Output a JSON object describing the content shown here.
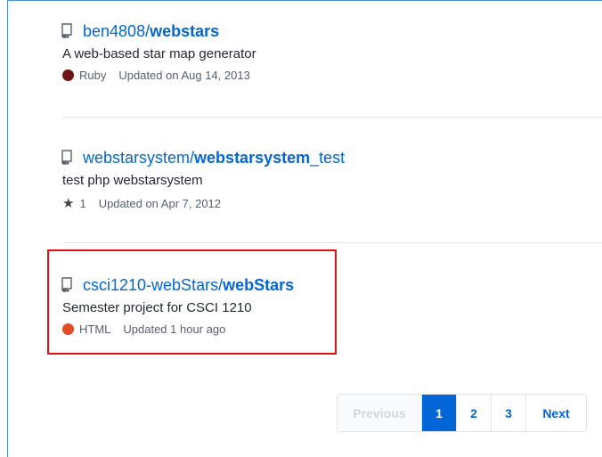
{
  "colors": {
    "link": "#0366d6",
    "ruby": "#701516",
    "html": "#e34c26",
    "highlight": "#dd1111"
  },
  "repos": [
    {
      "owner": "ben4808/",
      "name": "webstars",
      "name_suffix": "",
      "description": "A web-based star map generator",
      "language": "Ruby",
      "updated": "Updated on Aug 14, 2013"
    },
    {
      "owner": "webstarsystem/",
      "name": "webstarsystem",
      "name_suffix": "_test",
      "description": "test php webstarsystem",
      "stars": "1",
      "updated": "Updated on Apr 7, 2012"
    },
    {
      "owner": "csci1210-webStars/",
      "name": "webStars",
      "name_suffix": "",
      "description": "Semester project for CSCI 1210",
      "language": "HTML",
      "updated": "Updated 1 hour ago"
    }
  ],
  "pagination": {
    "previous": "Previous",
    "pages": [
      "1",
      "2",
      "3"
    ],
    "next": "Next"
  }
}
